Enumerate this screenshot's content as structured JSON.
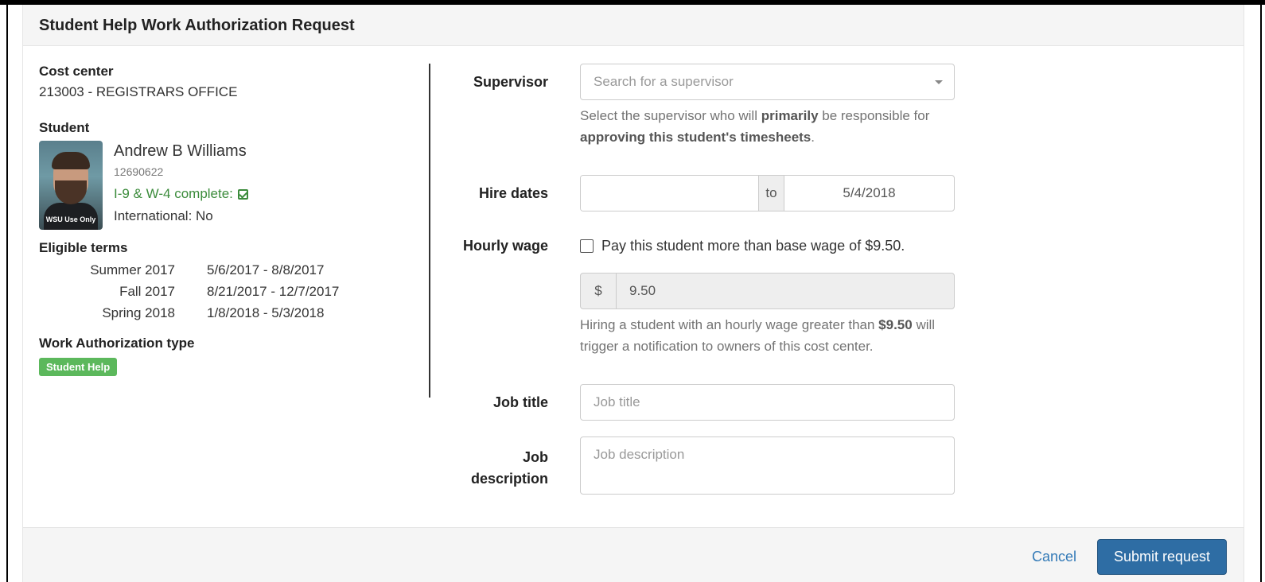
{
  "modal": {
    "title": "Student Help Work Authorization Request"
  },
  "cost_center": {
    "label": "Cost center",
    "value": "213003 - REGISTRARS OFFICE"
  },
  "student": {
    "label": "Student",
    "name": "Andrew B Williams",
    "id": "12690622",
    "i9_w4": "I-9 & W-4 complete:",
    "international": "International: No",
    "photo_watermark": "WSU Use Only"
  },
  "eligible_terms": {
    "label": "Eligible terms",
    "rows": [
      {
        "term": "Summer 2017",
        "dates": "5/6/2017 - 8/8/2017"
      },
      {
        "term": "Fall 2017",
        "dates": "8/21/2017 - 12/7/2017"
      },
      {
        "term": "Spring 2018",
        "dates": "1/8/2018 - 5/3/2018"
      }
    ]
  },
  "work_authorization": {
    "label": "Work Authorization type",
    "badge": "Student Help",
    "badge_color": "#5cb85c"
  },
  "form": {
    "supervisor": {
      "label": "Supervisor",
      "placeholder": "Search for a supervisor",
      "help_pre": "Select the supervisor who will ",
      "help_bold1": "primarily",
      "help_mid": " be responsible for ",
      "help_bold2": "approving this student's timesheets",
      "help_post": "."
    },
    "hire_dates": {
      "label": "Hire dates",
      "start": "",
      "separator": "to",
      "end": "5/4/2018"
    },
    "hourly_wage": {
      "label": "Hourly wage",
      "checkbox_label": "Pay this student more than base wage of $9.50.",
      "checked": false,
      "currency": "$",
      "value": "9.50",
      "help_pre": "Hiring a student with an hourly wage greater than ",
      "help_bold": "$9.50",
      "help_post": " will trigger a notification to owners of this cost center."
    },
    "job_title": {
      "label": "Job title",
      "placeholder": "Job title"
    },
    "job_description": {
      "label_line1": "Job",
      "label_line2": "description",
      "placeholder": "Job description"
    }
  },
  "footer": {
    "cancel": "Cancel",
    "submit": "Submit request",
    "accent": "#337ab7"
  }
}
